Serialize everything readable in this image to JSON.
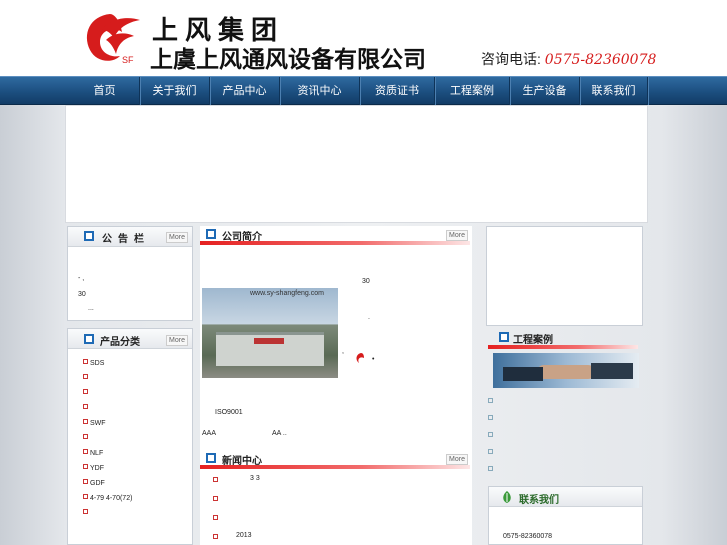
{
  "header": {
    "brand_top": "上风集团",
    "brand_sub": "上虞上风通风设备有限公司",
    "logo_letters": "SF",
    "hotline_label": "咨询电话:",
    "hotline_number": "0575-82360078"
  },
  "nav": {
    "items": [
      "首页",
      "关于我们",
      "产品中心",
      "资讯中心",
      "资质证书",
      "工程案例",
      "生产设备",
      "联系我们"
    ]
  },
  "notice": {
    "title": "公告栏",
    "more": "More",
    "lines": [
      "- ,",
      "30",
      "..."
    ]
  },
  "products": {
    "title": "产品分类",
    "more": "More",
    "items": [
      "SDS",
      "",
      "",
      "",
      "SWF",
      "",
      "NLF",
      "YDF",
      "GDF",
      "4-79 4-70(72)",
      ""
    ]
  },
  "about": {
    "title": "公司简介",
    "more": "More",
    "photo_caption": "www.sy-shangfeng.com",
    "texts": [
      "30",
      ".",
      ",",
      "•",
      "ISO9001",
      "AAA",
      "AA .."
    ]
  },
  "news": {
    "title": "新闻中心",
    "more": "More",
    "items": [
      "3  3",
      "",
      "",
      "2013"
    ]
  },
  "cases": {
    "title": "工程案例",
    "items": [
      "",
      "",
      "",
      "",
      "",
      ""
    ]
  },
  "contact": {
    "title": "联系我们",
    "phone": "0575-82360078"
  },
  "colors": {
    "nav": "#1c4f80",
    "accent_red": "#e52020",
    "box_icon": "#1e6ab5"
  }
}
